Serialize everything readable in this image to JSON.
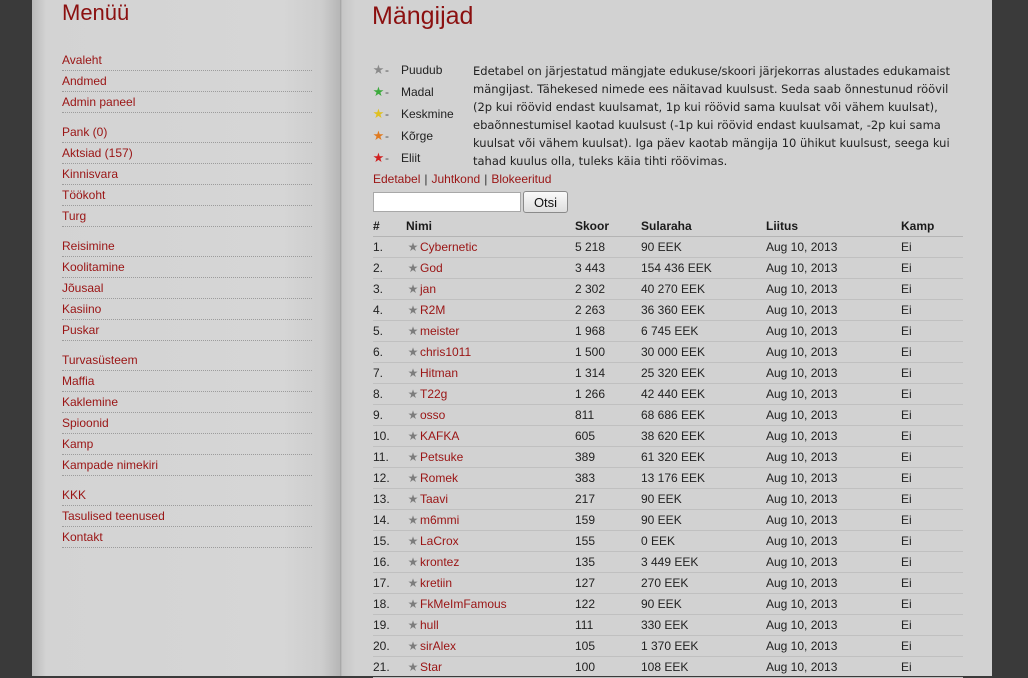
{
  "sidebar": {
    "title": "Menüü",
    "groups": [
      [
        "Avaleht",
        "Andmed",
        "Admin paneel"
      ],
      [
        "Pank (0)",
        "Aktsiad (157)",
        "Kinnisvara",
        "Töökoht",
        "Turg"
      ],
      [
        "Reisimine",
        "Koolitamine",
        "Jõusaal",
        "Kasiino",
        "Puskar"
      ],
      [
        "Turvasüsteem",
        "Maffia",
        "Kaklemine",
        "Spioonid",
        "Kamp",
        "Kampade nimekiri"
      ],
      [
        "KKK",
        "Tasulised teenused",
        "Kontakt"
      ]
    ]
  },
  "main": {
    "title": "Mängijad",
    "legend": [
      {
        "label": "Puudub",
        "color": "#8a8a8a",
        "icon": "star-gray-icon"
      },
      {
        "label": "Madal",
        "color": "#3caa3c",
        "icon": "star-green-icon"
      },
      {
        "label": "Keskmine",
        "color": "#e0c020",
        "icon": "star-yellow-icon"
      },
      {
        "label": "Kõrge",
        "color": "#e07a20",
        "icon": "star-orange-icon"
      },
      {
        "label": "Eliit",
        "color": "#d02020",
        "icon": "star-red-icon"
      }
    ],
    "legend_dash": "-",
    "description": "Edetabel on järjestatud mängjate edukuse/skoori järjekorras alustades edukamaist mängijast. Tähekesed nimede ees näitavad kuulsust. Seda saab õnnestunud röövil (2p kui röövid endast kuulsamat, 1p kui röövid sama kuulsat või vähem kuulsat), ebaõnnestumisel kaotad kuulsust (-1p kui röövid endast kuulsamat, -2p kui sama kuulsat või vähem kuulsat). Iga päev kaotab mängija 10 ühikut kuulsust, seega kui tahad kuulus olla, tuleks käia tihti röövimas.",
    "links": [
      "Edetabel",
      "Juhtkond",
      "Blokeeritud"
    ],
    "link_separator": "|",
    "search": {
      "value": "",
      "button_label": "Otsi"
    },
    "table": {
      "headers": [
        "#",
        "Nimi",
        "Skoor",
        "Sularaha",
        "Liitus",
        "Kamp"
      ],
      "rows": [
        {
          "rank": "1.",
          "name": "Cybernetic",
          "score": "5 218",
          "cash": "90 EEK",
          "joined": "Aug 10, 2013",
          "gang": "Ei"
        },
        {
          "rank": "2.",
          "name": "God",
          "score": "3 443",
          "cash": "154 436 EEK",
          "joined": "Aug 10, 2013",
          "gang": "Ei"
        },
        {
          "rank": "3.",
          "name": "jan",
          "score": "2 302",
          "cash": "40 270 EEK",
          "joined": "Aug 10, 2013",
          "gang": "Ei"
        },
        {
          "rank": "4.",
          "name": "R2M",
          "score": "2 263",
          "cash": "36 360 EEK",
          "joined": "Aug 10, 2013",
          "gang": "Ei"
        },
        {
          "rank": "5.",
          "name": "meister",
          "score": "1 968",
          "cash": "6 745 EEK",
          "joined": "Aug 10, 2013",
          "gang": "Ei"
        },
        {
          "rank": "6.",
          "name": "chris1011",
          "score": "1 500",
          "cash": "30 000 EEK",
          "joined": "Aug 10, 2013",
          "gang": "Ei"
        },
        {
          "rank": "7.",
          "name": "Hitman",
          "score": "1 314",
          "cash": "25 320 EEK",
          "joined": "Aug 10, 2013",
          "gang": "Ei"
        },
        {
          "rank": "8.",
          "name": "T22g",
          "score": "1 266",
          "cash": "42 440 EEK",
          "joined": "Aug 10, 2013",
          "gang": "Ei"
        },
        {
          "rank": "9.",
          "name": "osso",
          "score": "811",
          "cash": "68 686 EEK",
          "joined": "Aug 10, 2013",
          "gang": "Ei"
        },
        {
          "rank": "10.",
          "name": "KAFKA",
          "score": "605",
          "cash": "38 620 EEK",
          "joined": "Aug 10, 2013",
          "gang": "Ei"
        },
        {
          "rank": "11.",
          "name": "Petsuke",
          "score": "389",
          "cash": "61 320 EEK",
          "joined": "Aug 10, 2013",
          "gang": "Ei"
        },
        {
          "rank": "12.",
          "name": "Romek",
          "score": "383",
          "cash": "13 176 EEK",
          "joined": "Aug 10, 2013",
          "gang": "Ei"
        },
        {
          "rank": "13.",
          "name": "Taavi",
          "score": "217",
          "cash": "90 EEK",
          "joined": "Aug 10, 2013",
          "gang": "Ei"
        },
        {
          "rank": "14.",
          "name": "m6mmi",
          "score": "159",
          "cash": "90 EEK",
          "joined": "Aug 10, 2013",
          "gang": "Ei"
        },
        {
          "rank": "15.",
          "name": "LaCrox",
          "score": "155",
          "cash": "0 EEK",
          "joined": "Aug 10, 2013",
          "gang": "Ei"
        },
        {
          "rank": "16.",
          "name": "krontez",
          "score": "135",
          "cash": "3 449 EEK",
          "joined": "Aug 10, 2013",
          "gang": "Ei"
        },
        {
          "rank": "17.",
          "name": "kretiin",
          "score": "127",
          "cash": "270 EEK",
          "joined": "Aug 10, 2013",
          "gang": "Ei"
        },
        {
          "rank": "18.",
          "name": "FkMeImFamous",
          "score": "122",
          "cash": "90 EEK",
          "joined": "Aug 10, 2013",
          "gang": "Ei"
        },
        {
          "rank": "19.",
          "name": "hull",
          "score": "111",
          "cash": "330 EEK",
          "joined": "Aug 10, 2013",
          "gang": "Ei"
        },
        {
          "rank": "20.",
          "name": "sirAlex",
          "score": "105",
          "cash": "1 370 EEK",
          "joined": "Aug 10, 2013",
          "gang": "Ei"
        },
        {
          "rank": "21.",
          "name": "Star",
          "score": "100",
          "cash": "108 EEK",
          "joined": "Aug 10, 2013",
          "gang": "Ei"
        }
      ]
    }
  }
}
